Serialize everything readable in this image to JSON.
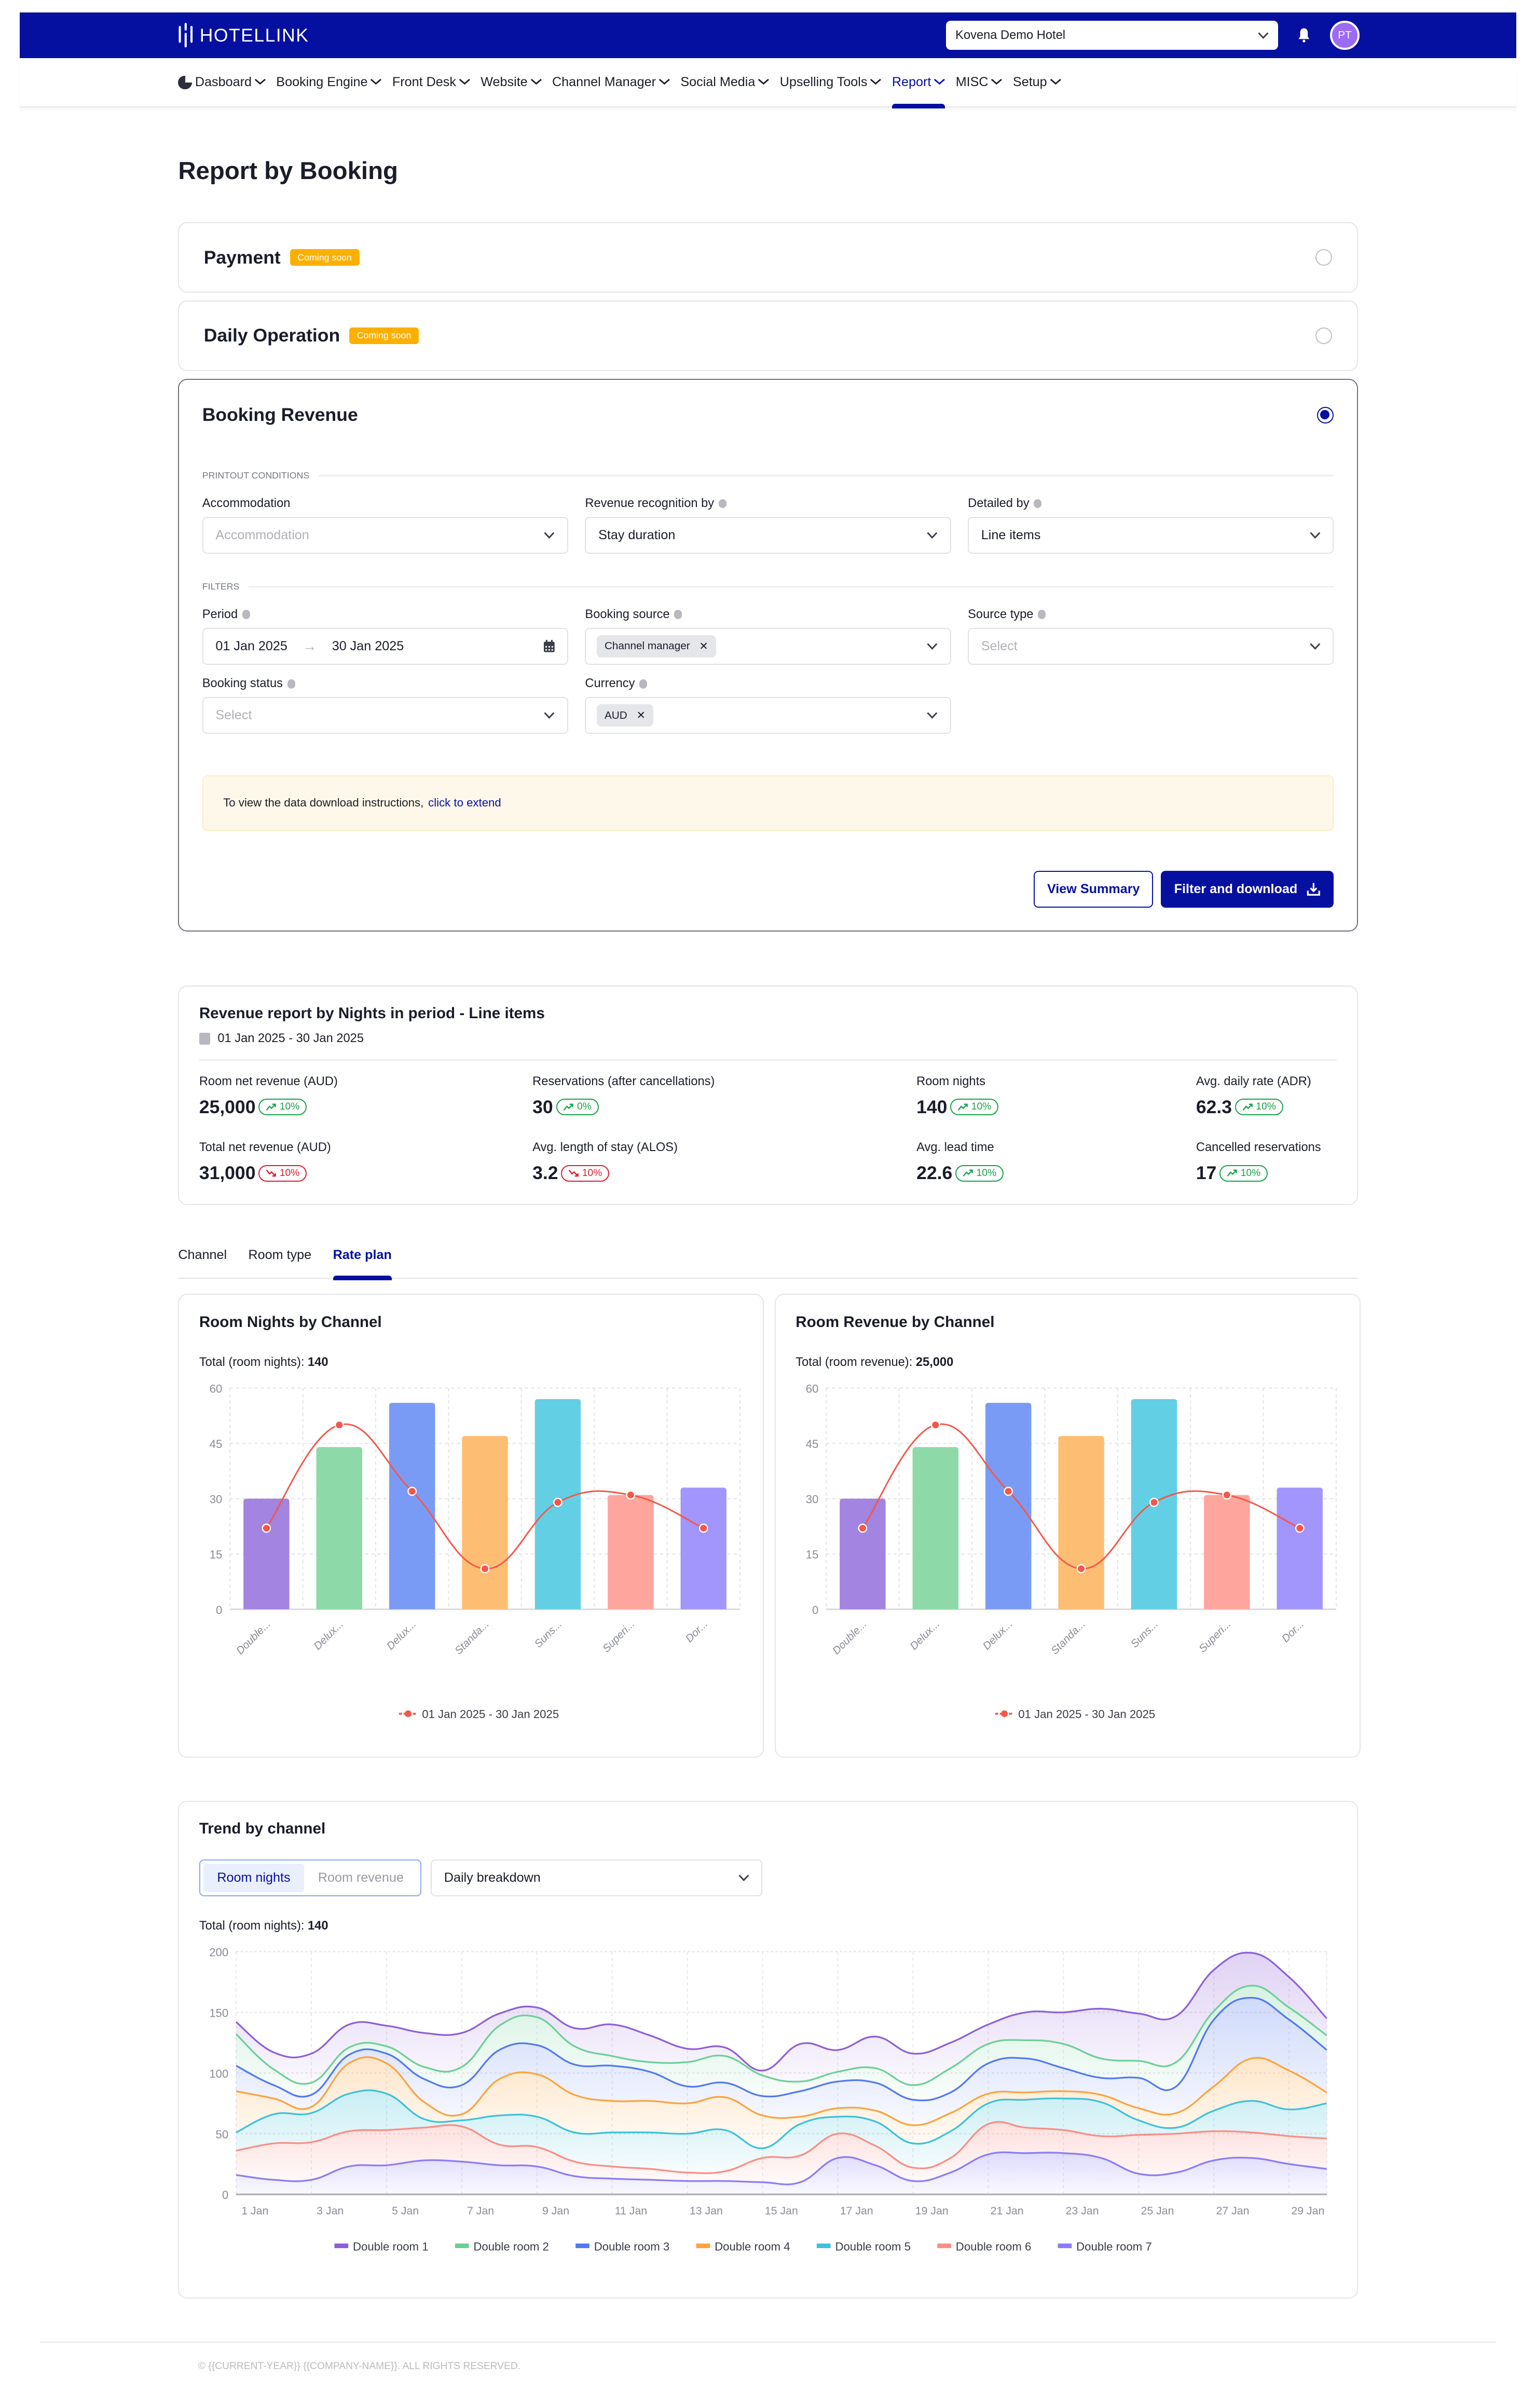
{
  "header": {
    "brand": "HOTELLINK",
    "hotel_selector": "Kovena Demo Hotel",
    "avatar_initials": "PT",
    "colors": {
      "brand": "#0610a0",
      "avatar": "#9b6bf5"
    }
  },
  "nav": {
    "items": [
      {
        "label": "Dasboard",
        "active": false
      },
      {
        "label": "Booking Engine",
        "active": false
      },
      {
        "label": "Front Desk",
        "active": false
      },
      {
        "label": "Website",
        "active": false
      },
      {
        "label": "Channel Manager",
        "active": false
      },
      {
        "label": "Social Media",
        "active": false
      },
      {
        "label": "Upselling Tools",
        "active": false
      },
      {
        "label": "Report",
        "active": true
      },
      {
        "label": "MISC",
        "active": false
      },
      {
        "label": "Setup",
        "active": false
      }
    ]
  },
  "page": {
    "title": "Report by Booking"
  },
  "report_options": [
    {
      "title": "Payment",
      "badge": "Coming soon",
      "selected": false
    },
    {
      "title": "Daily Operation",
      "badge": "Coming soon",
      "selected": false
    },
    {
      "title": "Booking Revenue",
      "badge": "",
      "selected": true
    }
  ],
  "booking_revenue": {
    "printout_label": "PRINTOUT CONDITIONS",
    "filters_label": "FILTERS",
    "accommodation": {
      "label": "Accommodation",
      "placeholder": "Accommodation",
      "value": ""
    },
    "revenue_recognition": {
      "label": "Revenue recognition by",
      "value": "Stay duration"
    },
    "detailed_by": {
      "label": "Detailed by",
      "value": "Line items"
    },
    "period": {
      "label": "Period",
      "from": "01 Jan 2025",
      "to": "30 Jan 2025"
    },
    "booking_source": {
      "label": "Booking source",
      "tags": [
        "Channel manager"
      ]
    },
    "source_type": {
      "label": "Source type",
      "placeholder": "Select"
    },
    "booking_status": {
      "label": "Booking status",
      "placeholder": "Select"
    },
    "currency": {
      "label": "Currency",
      "tags": [
        "AUD"
      ]
    },
    "notice_text": "To view the data download instructions,",
    "notice_link": "click to extend",
    "view_summary_label": "View Summary",
    "filter_download_label": "Filter and download"
  },
  "summary": {
    "title": "Revenue report by Nights in period - Line items",
    "date_range": "01 Jan 2025 - 30 Jan 2025",
    "kpis": [
      {
        "label": "Room net revenue (AUD)",
        "value": "25,000",
        "delta": "10%",
        "trend": "up"
      },
      {
        "label": "Reservations (after cancellations)",
        "value": "30",
        "delta": "0%",
        "trend": "up"
      },
      {
        "label": "Room nights",
        "value": "140",
        "delta": "10%",
        "trend": "up"
      },
      {
        "label": "Avg. daily rate (ADR)",
        "value": "62.3",
        "delta": "10%",
        "trend": "up"
      },
      {
        "label": "Total net revenue (AUD)",
        "value": "31,000",
        "delta": "10%",
        "trend": "down"
      },
      {
        "label": "Avg. length of stay (ALOS)",
        "value": "3.2",
        "delta": "10%",
        "trend": "down"
      },
      {
        "label": "Avg. lead time",
        "value": "22.6",
        "delta": "10%",
        "trend": "up"
      },
      {
        "label": "Cancelled reservations",
        "value": "17",
        "delta": "10%",
        "trend": "up"
      }
    ]
  },
  "tabs": [
    {
      "label": "Channel",
      "active": false
    },
    {
      "label": "Room type",
      "active": false
    },
    {
      "label": "Rate plan",
      "active": true
    }
  ],
  "room_nights_card": {
    "title": "Room Nights by Channel",
    "total_label": "Total (room nights):",
    "total_value": "140"
  },
  "room_revenue_card": {
    "title": "Room Revenue by Channel",
    "total_label": "Total (room revenue):",
    "total_value": "25,000"
  },
  "trend": {
    "title": "Trend by channel",
    "toggle": [
      {
        "label": "Room nights",
        "active": true
      },
      {
        "label": "Room revenue",
        "active": false
      }
    ],
    "breakdown": "Daily breakdown",
    "total_label": "Total (room nights):",
    "total_value": "140"
  },
  "footer": {
    "text": "© {{CURRENT-YEAR}} {{COMPANY-NAME}}. ALL RIGHTS RESERVED."
  },
  "chart_data": [
    {
      "id": "room-nights-by-channel",
      "type": "bar",
      "title": "Room Nights by Channel",
      "categories": [
        "Double...",
        "Delux...",
        "Delux...",
        "Standa...",
        "Suns...",
        "Superi...",
        "Dor..."
      ],
      "bar_colors": [
        "#a384e0",
        "#8ddaa8",
        "#7a9bf5",
        "#fdbe73",
        "#63cfe4",
        "#fea69e",
        "#a295fb"
      ],
      "values": [
        30,
        44,
        56,
        47,
        57,
        31,
        33
      ],
      "series": [
        {
          "name": "01 Jan 2025 - 30 Jan 2025",
          "type": "line",
          "color": "#f4574a",
          "values": [
            22,
            50,
            32,
            11,
            29,
            31,
            22
          ]
        }
      ],
      "yticks": [
        0,
        15,
        30,
        45,
        60
      ],
      "ylim": [
        0,
        60
      ],
      "grid": true,
      "legend": "bottom-center"
    },
    {
      "id": "room-revenue-by-channel",
      "type": "bar",
      "title": "Room Revenue by Channel",
      "categories": [
        "Double...",
        "Delux...",
        "Delux...",
        "Standa...",
        "Suns...",
        "Superi...",
        "Dor..."
      ],
      "bar_colors": [
        "#a384e0",
        "#8ddaa8",
        "#7a9bf5",
        "#fdbe73",
        "#63cfe4",
        "#fea69e",
        "#a295fb"
      ],
      "values": [
        30,
        44,
        56,
        47,
        57,
        31,
        33
      ],
      "series": [
        {
          "name": "01 Jan 2025 - 30 Jan 2025",
          "type": "line",
          "color": "#f4574a",
          "values": [
            22,
            50,
            32,
            11,
            29,
            31,
            22
          ]
        }
      ],
      "yticks": [
        0,
        15,
        30,
        45,
        60
      ],
      "ylim": [
        0,
        60
      ],
      "grid": true,
      "legend": "bottom-center"
    },
    {
      "id": "trend-by-channel",
      "type": "area",
      "stacked": true,
      "title": "Trend by channel",
      "x": [
        "1 Jan",
        "2 Jan",
        "3 Jan",
        "4 Jan",
        "5 Jan",
        "6 Jan",
        "7 Jan",
        "8 Jan",
        "9 Jan",
        "10 Jan",
        "11 Jan",
        "12 Jan",
        "13 Jan",
        "14 Jan",
        "15 Jan",
        "16 Jan",
        "17 Jan",
        "18 Jan",
        "19 Jan",
        "20 Jan",
        "21 Jan",
        "22 Jan",
        "23 Jan",
        "24 Jan",
        "25 Jan",
        "26 Jan",
        "27 Jan",
        "28 Jan",
        "29 Jan",
        "30 Jan"
      ],
      "xticks": [
        "1 Jan",
        "3 Jan",
        "5 Jan",
        "7 Jan",
        "9 Jan",
        "11 Jan",
        "13 Jan",
        "15 Jan",
        "17 Jan",
        "19 Jan",
        "21 Jan",
        "23 Jan",
        "25 Jan",
        "27 Jan",
        "29 Jan"
      ],
      "yticks": [
        0,
        50,
        100,
        150,
        200
      ],
      "ylim": [
        0,
        200
      ],
      "grid": true,
      "legend": "bottom-center",
      "series": [
        {
          "name": "Double room 7",
          "color": "#8b7cf6",
          "values": [
            16,
            12,
            12,
            23,
            24,
            28,
            27,
            24,
            23,
            15,
            13,
            12,
            11,
            11,
            10,
            10,
            30,
            24,
            11,
            18,
            33,
            34,
            34,
            30,
            17,
            18,
            28,
            30,
            25,
            21
          ]
        },
        {
          "name": "Double room 6",
          "color": "#fa8d86",
          "values": [
            20,
            30,
            31,
            29,
            29,
            27,
            29,
            17,
            16,
            12,
            10,
            9,
            7,
            8,
            20,
            22,
            20,
            16,
            11,
            12,
            25,
            21,
            19,
            18,
            32,
            32,
            24,
            21,
            23,
            25
          ]
        },
        {
          "name": "Double room 5",
          "color": "#3ec1d9",
          "values": [
            15,
            24,
            24,
            31,
            30,
            7,
            5,
            24,
            25,
            24,
            28,
            30,
            32,
            34,
            8,
            26,
            14,
            20,
            20,
            22,
            17,
            23,
            26,
            28,
            12,
            5,
            17,
            26,
            22,
            29
          ]
        },
        {
          "name": "Double room 4",
          "color": "#fba43f",
          "values": [
            34,
            13,
            5,
            25,
            25,
            14,
            5,
            30,
            35,
            31,
            26,
            26,
            25,
            27,
            27,
            6,
            7,
            9,
            15,
            15,
            8,
            6,
            6,
            6,
            10,
            12,
            20,
            35,
            32,
            9
          ]
        },
        {
          "name": "Double room 3",
          "color": "#5379f0",
          "values": [
            21,
            11,
            10,
            7,
            8,
            19,
            24,
            24,
            24,
            25,
            29,
            24,
            14,
            12,
            16,
            21,
            22,
            23,
            21,
            17,
            25,
            28,
            19,
            14,
            25,
            22,
            55,
            50,
            42,
            35
          ]
        },
        {
          "name": "Double room 2",
          "color": "#6dcf97",
          "values": [
            26,
            13,
            10,
            6,
            6,
            10,
            15,
            20,
            23,
            15,
            8,
            8,
            20,
            22,
            17,
            8,
            8,
            12,
            12,
            20,
            16,
            15,
            20,
            16,
            14,
            20,
            7,
            10,
            10,
            12
          ]
        },
        {
          "name": "Double room 1",
          "color": "#8e5fd9",
          "values": [
            10,
            14,
            24,
            19,
            17,
            28,
            28,
            10,
            8,
            15,
            26,
            22,
            11,
            7,
            4,
            31,
            18,
            26,
            26,
            21,
            16,
            23,
            26,
            41,
            39,
            38,
            34,
            27,
            25,
            14
          ]
        }
      ]
    }
  ]
}
